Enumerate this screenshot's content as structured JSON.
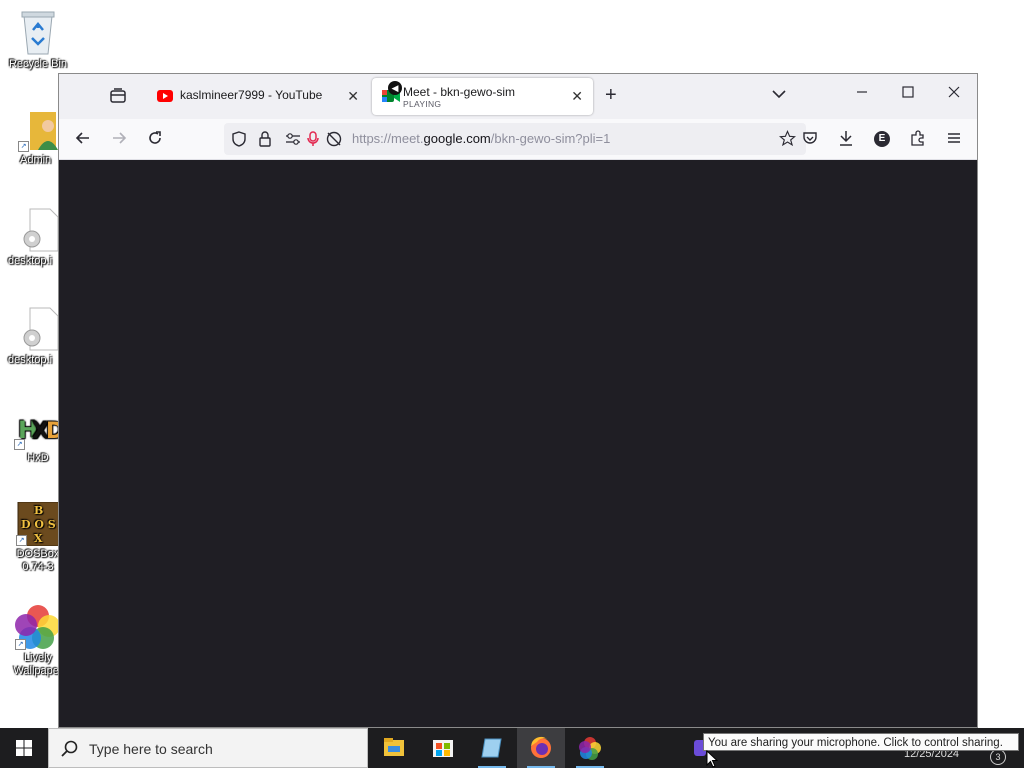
{
  "desktop": {
    "icons": [
      {
        "label": "Recycle Bin"
      },
      {
        "label": "Admin"
      },
      {
        "label": "desktop.i"
      },
      {
        "label": "desktop.i"
      },
      {
        "label": "HxD"
      },
      {
        "label": "DOSBox 0.74-3"
      },
      {
        "label": "Lively Wallpaper"
      }
    ]
  },
  "browser": {
    "tabs": [
      {
        "title": "kaslmineer7999 - YouTube",
        "icon": "youtube-icon"
      },
      {
        "title": "Meet - bkn-gewo-sim",
        "subtitle": "PLAYING",
        "icon": "google-meet-icon"
      }
    ],
    "url": {
      "prefix": "https://meet.",
      "domain": "google.com",
      "path": "/bkn-gewo-sim?pli=1"
    },
    "account_initial": "E",
    "colors": {
      "content_bg": "#1f1e24",
      "mic_red": "#e22850"
    }
  },
  "taskbar": {
    "search_placeholder": "Type here to search",
    "tooltip": "You are sharing your microphone. Click to control sharing.",
    "date": "12/25/2024",
    "notification_count": "3"
  }
}
